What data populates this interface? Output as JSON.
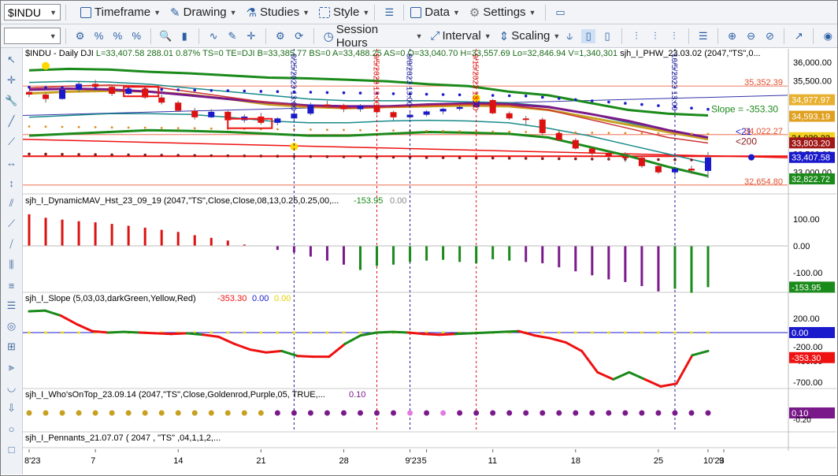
{
  "toolbar": {
    "symbol": "$INDU",
    "menus": [
      "Timeframe",
      "Drawing",
      "Studies",
      "Style",
      "Data",
      "Settings"
    ],
    "menus2": [
      "Session Hours",
      "Interval",
      "Scaling"
    ]
  },
  "colors": {
    "up_bar": "#1a1acc",
    "down_bar": "#dd1111",
    "hist_pos": "#dd1111",
    "hist_neg_purple": "#7a1a8a",
    "hist_neg_green": "#1a8a1a",
    "slope_up": "#1a8a1a",
    "slope_down": "#ee1111",
    "band_green": "#1a8a1a",
    "band_teal": "#1a8a8a",
    "goldenrod": "#c8a020",
    "purple": "#7a1a8a",
    "crosshair_blue": "#1a1a99",
    "crosshair_red": "#dd1111"
  },
  "chart_data": [
    {
      "type": "line",
      "name": "price-pane",
      "header": {
        "symbol": "$INDU",
        "period": "Daily",
        "exchange": "DJI",
        "fields": "L=33,407.58  288.01  0.87%  TS=0  TE=DJI  B=33,385.77  BS=0  A=33,488.25  AS=0  O=33,040.70  H=33,557.69  Lo=32,846.94  V=1,340,301",
        "study": "sjh_I_PHW_23.03.02 (2047,\"TS\",0..."
      },
      "x_ticks": [
        "8'23",
        "7",
        "14",
        "21",
        "28",
        "9'23",
        "5",
        "11",
        "18",
        "25",
        "10'23",
        "9"
      ],
      "y_ticks": [
        "36,000.00",
        "35,500.00",
        "35,000.00",
        "34,500.00",
        "34,000.00",
        "33,500.00",
        "33,000.00"
      ],
      "ylim": [
        32500,
        36150
      ],
      "markers": [
        {
          "label": "35,352.39",
          "value": 35352.39
        },
        {
          "label": "34,977.97",
          "value": 34977.97
        },
        {
          "label": "34,593.19",
          "value": 34593.19
        },
        {
          "label": "34,029.22",
          "value": 34029.22
        },
        {
          "label": "34,022.27",
          "value": 34022.27
        },
        {
          "label": "33,803.20",
          "value": 33803.2
        },
        {
          "label": "33,407.58",
          "value": 33407.58
        },
        {
          "label": "32,822.72",
          "value": 32822.72
        },
        {
          "label": "32,654.80",
          "value": 32654.8
        }
      ],
      "annotations": {
        "slope_text": "Slope = -353.30",
        "sma21": "<21",
        "sma200": "<200",
        "vlines": [
          "8/25/2023 13:00",
          "9/5/2023 13:00",
          "9/8/2023 13:00",
          "9/15/2023 13:00",
          "10/5/2023 13:00"
        ]
      },
      "bars": [
        {
          "o": 35190,
          "h": 35230,
          "l": 35050,
          "c": 35120
        },
        {
          "o": 35120,
          "h": 35170,
          "l": 34900,
          "c": 35000
        },
        {
          "o": 35000,
          "h": 35290,
          "l": 34980,
          "c": 35250
        },
        {
          "o": 35250,
          "h": 35480,
          "l": 35180,
          "c": 35410
        },
        {
          "o": 35410,
          "h": 35520,
          "l": 35300,
          "c": 35330
        },
        {
          "o": 35330,
          "h": 35380,
          "l": 35080,
          "c": 35140
        },
        {
          "o": 35140,
          "h": 35300,
          "l": 35120,
          "c": 35280
        },
        {
          "o": 35280,
          "h": 35320,
          "l": 35000,
          "c": 35040
        },
        {
          "o": 35040,
          "h": 35120,
          "l": 34850,
          "c": 34900
        },
        {
          "o": 34900,
          "h": 34950,
          "l": 34650,
          "c": 34680
        },
        {
          "o": 34680,
          "h": 34760,
          "l": 34440,
          "c": 34500
        },
        {
          "o": 34500,
          "h": 34720,
          "l": 34480,
          "c": 34650
        },
        {
          "o": 34650,
          "h": 34680,
          "l": 34380,
          "c": 34420
        },
        {
          "o": 34420,
          "h": 34580,
          "l": 34350,
          "c": 34520
        },
        {
          "o": 34520,
          "h": 34620,
          "l": 34300,
          "c": 34350
        },
        {
          "o": 34350,
          "h": 34500,
          "l": 34280,
          "c": 34470
        },
        {
          "o": 34470,
          "h": 34640,
          "l": 34420,
          "c": 34600
        },
        {
          "o": 34600,
          "h": 34900,
          "l": 34560,
          "c": 34850
        },
        {
          "o": 34850,
          "h": 34950,
          "l": 34780,
          "c": 34830
        },
        {
          "o": 34830,
          "h": 34870,
          "l": 34640,
          "c": 34720
        },
        {
          "o": 34720,
          "h": 34860,
          "l": 34650,
          "c": 34820
        },
        {
          "o": 34820,
          "h": 34860,
          "l": 34580,
          "c": 34640
        },
        {
          "o": 34640,
          "h": 34680,
          "l": 34420,
          "c": 34500
        },
        {
          "o": 34500,
          "h": 34620,
          "l": 34450,
          "c": 34570
        },
        {
          "o": 34570,
          "h": 34700,
          "l": 34520,
          "c": 34660
        },
        {
          "o": 34660,
          "h": 34760,
          "l": 34580,
          "c": 34730
        },
        {
          "o": 34730,
          "h": 34820,
          "l": 34680,
          "c": 34780
        },
        {
          "o": 34780,
          "h": 35020,
          "l": 34760,
          "c": 34970
        },
        {
          "o": 34970,
          "h": 35000,
          "l": 34580,
          "c": 34610
        },
        {
          "o": 34610,
          "h": 34660,
          "l": 34430,
          "c": 34470
        },
        {
          "o": 34470,
          "h": 34540,
          "l": 34280,
          "c": 34440
        },
        {
          "o": 34440,
          "h": 34490,
          "l": 34020,
          "c": 34070
        },
        {
          "o": 34070,
          "h": 34120,
          "l": 33850,
          "c": 33880
        },
        {
          "o": 33880,
          "h": 33930,
          "l": 33620,
          "c": 33650
        },
        {
          "o": 33650,
          "h": 33700,
          "l": 33450,
          "c": 33510
        },
        {
          "o": 33510,
          "h": 33600,
          "l": 33350,
          "c": 33430
        },
        {
          "o": 33430,
          "h": 33550,
          "l": 33280,
          "c": 33400
        },
        {
          "o": 33400,
          "h": 33450,
          "l": 33120,
          "c": 33170
        },
        {
          "o": 33170,
          "h": 33220,
          "l": 32960,
          "c": 33000
        },
        {
          "o": 33000,
          "h": 33150,
          "l": 32900,
          "c": 33100
        },
        {
          "o": 33100,
          "h": 33180,
          "l": 32960,
          "c": 33050
        },
        {
          "o": 33040,
          "h": 33558,
          "l": 32847,
          "c": 33408
        }
      ]
    },
    {
      "type": "bar",
      "name": "dynamic-mav-histogram",
      "title": "sjh_I_DynamicMAV_Hst_23_09_19 (2047,\"TS\",Close,Close,08,13,0.25,0.25,00,...",
      "value_labels": [
        "-153.95",
        "0.00"
      ],
      "y_ticks": [
        "100.00",
        "0.00",
        "-100.00"
      ],
      "ylim": [
        -200,
        150
      ],
      "last_label": "-153.95",
      "values": [
        118,
        105,
        98,
        92,
        88,
        82,
        75,
        68,
        60,
        52,
        40,
        30,
        20,
        5,
        0,
        -15,
        -25,
        -40,
        -55,
        -70,
        -90,
        -75,
        -70,
        -60,
        -55,
        -52,
        -60,
        -65,
        -50,
        -55,
        -60,
        -65,
        -80,
        -95,
        -110,
        -125,
        -135,
        -150,
        -170,
        -160,
        -175,
        -154
      ],
      "colors": [
        "r",
        "r",
        "r",
        "r",
        "r",
        "r",
        "r",
        "r",
        "r",
        "r",
        "r",
        "r",
        "r",
        "r",
        "r",
        "p",
        "p",
        "p",
        "p",
        "p",
        "g",
        "g",
        "g",
        "g",
        "g",
        "g",
        "g",
        "g",
        "g",
        "g",
        "p",
        "p",
        "p",
        "p",
        "p",
        "p",
        "p",
        "p",
        "p",
        "g",
        "g",
        "g"
      ]
    },
    {
      "type": "line",
      "name": "slope-pane",
      "title": "sjh_I_Slope (5,03,03,darkGreen,Yellow,Red)",
      "value_labels": [
        "-353.30",
        "0.00",
        "0.00"
      ],
      "y_ticks": [
        "200.00",
        "0.00",
        "-200.00",
        "-400.00",
        "-700.00"
      ],
      "ylim": [
        -900,
        400
      ],
      "last_labels": [
        "0.00",
        "-353.30"
      ],
      "values": [
        300,
        310,
        240,
        120,
        20,
        0,
        10,
        0,
        -10,
        -20,
        -10,
        -30,
        -60,
        -160,
        -240,
        -280,
        -260,
        -330,
        -340,
        -340,
        -160,
        -40,
        0,
        10,
        0,
        -20,
        -30,
        -20,
        -10,
        0,
        10,
        20,
        -40,
        -80,
        -140,
        -260,
        -560,
        -660,
        -560,
        -660,
        -760,
        -720,
        -320,
        -260
      ],
      "series_colors": [
        "g",
        "g",
        "r",
        "r",
        "r",
        "g",
        "g",
        "r",
        "r",
        "r",
        "g",
        "r",
        "r",
        "r",
        "r",
        "r",
        "g",
        "r",
        "r",
        "r",
        "g",
        "g",
        "g",
        "g",
        "r",
        "r",
        "r",
        "g",
        "g",
        "g",
        "g",
        "r",
        "r",
        "r",
        "r",
        "r",
        "r",
        "g",
        "g",
        "r",
        "r",
        "r",
        "g",
        "g"
      ]
    },
    {
      "type": "scatter",
      "name": "whos-on-top-pane",
      "title": "sjh_I_Who'sOnTop_23.09.14 (2047,\"TS\",Close,Goldenrod,Purple,05,  TRUE,...",
      "value_label": "0.10",
      "y_ticks": [
        "-0.20"
      ],
      "last_label": "0.10",
      "dots": [
        "o",
        "o",
        "o",
        "o",
        "o",
        "o",
        "o",
        "o",
        "o",
        "o",
        "o",
        "o",
        "o",
        "o",
        "o",
        "p",
        "p",
        "p",
        "p",
        "p",
        "p",
        "p",
        "p",
        "l",
        "p",
        "l",
        "p",
        "p",
        "p",
        "p",
        "p",
        "p",
        "p",
        "p",
        "p",
        "p",
        "p",
        "p",
        "p",
        "p",
        "p",
        "p"
      ]
    },
    {
      "type": "table",
      "name": "pennants-pane",
      "title": "sjh_I_Pennants_21.07.07 (  2047 ,  \"TS\" ,04,1,1,2,...",
      "values": []
    }
  ]
}
